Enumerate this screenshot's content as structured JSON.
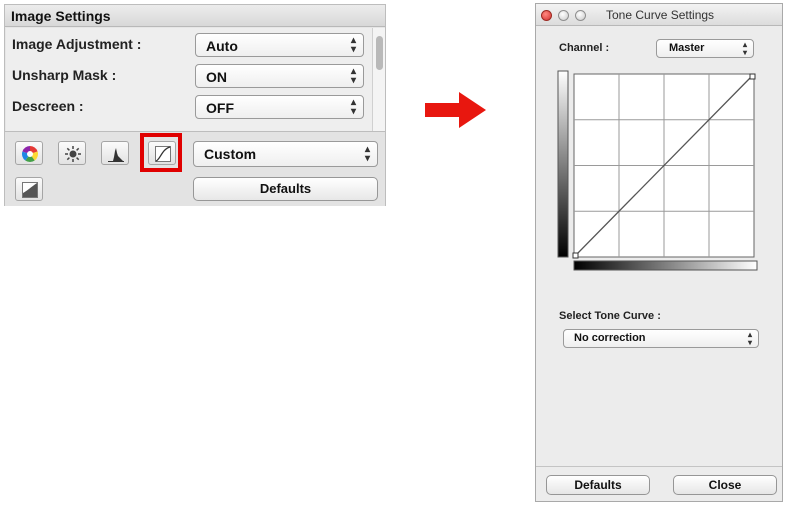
{
  "image_settings": {
    "title": "Image Settings",
    "rows": [
      {
        "label": "Image Adjustment :",
        "value": "Auto"
      },
      {
        "label": "Unsharp Mask :",
        "value": "ON"
      },
      {
        "label": "Descreen :",
        "value": "OFF"
      }
    ],
    "toolbar": {
      "tools": [
        "saturation-color-balance-icon",
        "brightness-contrast-icon",
        "histogram-icon",
        "tone-curve-icon",
        "final-review-icon"
      ],
      "preset_value": "Custom",
      "defaults_label": "Defaults"
    }
  },
  "highlight_color": "#e00000",
  "arrow_color": "#e8170f",
  "tone_curve_window": {
    "title": "Tone Curve Settings",
    "channel_label": "Channel :",
    "channel_value": "Master",
    "select_curve_label": "Select Tone Curve :",
    "select_curve_value": "No correction",
    "defaults_label": "Defaults",
    "close_label": "Close",
    "curve": {
      "input": [
        0,
        255
      ],
      "output": [
        0,
        255
      ],
      "grid_divisions": 4
    }
  }
}
